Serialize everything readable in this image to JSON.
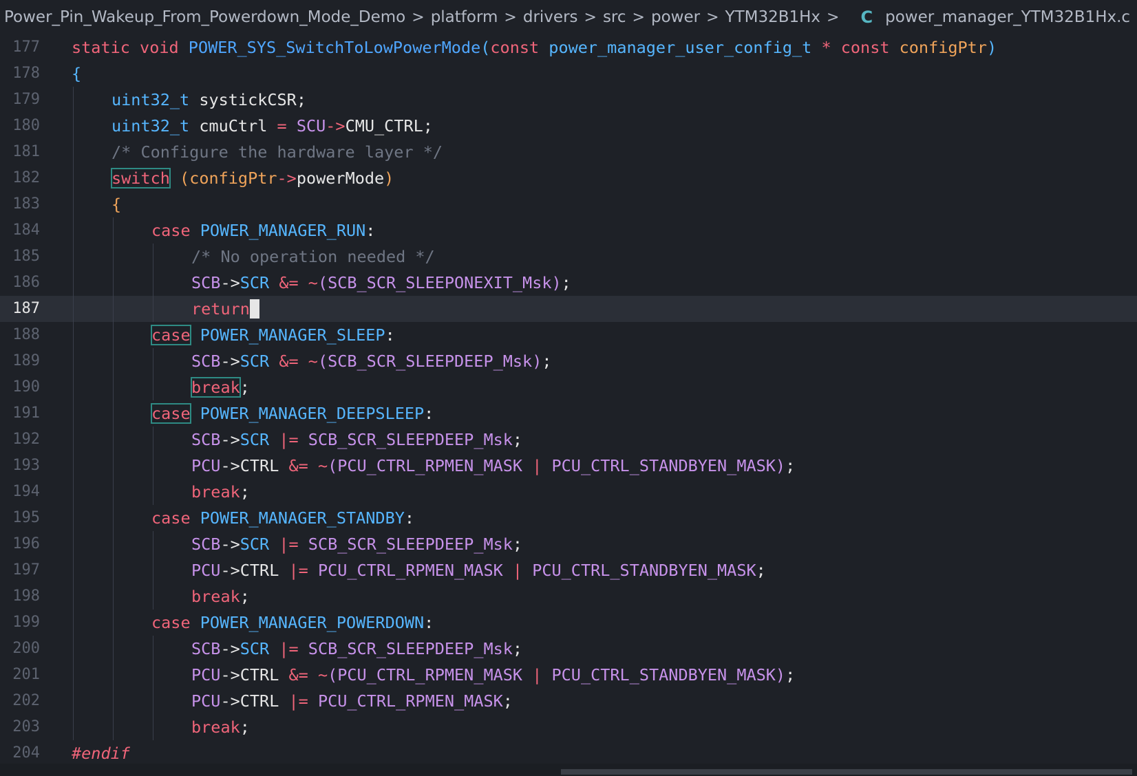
{
  "breadcrumb": {
    "items": [
      "Power_Pin_Wakeup_From_Powerdown_Mode_Demo",
      "platform",
      "drivers",
      "src",
      "power",
      "YTM32B1Hx"
    ],
    "file_icon": "C",
    "file": "power_manager_YTM32B1Hx.c",
    "separator": ">"
  },
  "colors": {
    "keyword": "#f0657a",
    "type": "#56b6ff",
    "function": "#4fa6ff",
    "macro": "#c792ea",
    "param": "#f0a45a",
    "comment": "#6f7684",
    "text": "#e6e6e6",
    "background": "#1e2127"
  },
  "editor": {
    "current_line": 187,
    "lines": [
      {
        "n": "177",
        "indent": 0,
        "tokens": [
          [
            "k",
            "static "
          ],
          [
            "k",
            "void "
          ],
          [
            "f",
            "POWER_SYS_SwitchToLowPowerMode"
          ],
          [
            "p",
            "("
          ],
          [
            "k",
            "const "
          ],
          [
            "t",
            "power_manager_user_config_t "
          ],
          [
            "k",
            "* "
          ],
          [
            "k",
            "const "
          ],
          [
            "a",
            "configPtr"
          ],
          [
            "p",
            ")"
          ]
        ]
      },
      {
        "n": "178",
        "indent": 0,
        "tokens": [
          [
            "p",
            "{"
          ]
        ]
      },
      {
        "n": "179",
        "indent": 1,
        "tokens": [
          [
            "t",
            "uint32_t "
          ],
          [
            "w",
            "systickCSR;"
          ]
        ]
      },
      {
        "n": "180",
        "indent": 1,
        "tokens": [
          [
            "t",
            "uint32_t "
          ],
          [
            "w",
            "cmuCtrl "
          ],
          [
            "k",
            "= "
          ],
          [
            "m",
            "SCU"
          ],
          [
            "k",
            "->"
          ],
          [
            "w",
            "CMU_CTRL;"
          ]
        ]
      },
      {
        "n": "181",
        "indent": 1,
        "tokens": [
          [
            "c",
            "/* Configure the hardware layer */"
          ]
        ]
      },
      {
        "n": "182",
        "indent": 1,
        "tokens": [
          [
            "kb",
            "switch"
          ],
          [
            "w",
            " "
          ],
          [
            "a",
            "(configPtr"
          ],
          [
            "k",
            "->"
          ],
          [
            "w",
            "powerMode"
          ],
          [
            "a",
            ")"
          ]
        ]
      },
      {
        "n": "183",
        "indent": 1,
        "tokens": [
          [
            "a",
            "{"
          ]
        ]
      },
      {
        "n": "184",
        "indent": 2,
        "tokens": [
          [
            "k",
            "case "
          ],
          [
            "t",
            "POWER_MANAGER_RUN"
          ],
          [
            "w",
            ":"
          ]
        ]
      },
      {
        "n": "185",
        "indent": 3,
        "tokens": [
          [
            "c",
            "/* No operation needed */"
          ]
        ]
      },
      {
        "n": "186",
        "indent": 3,
        "tokens": [
          [
            "m",
            "SCB"
          ],
          [
            "w",
            "->"
          ],
          [
            "t",
            "SCR "
          ],
          [
            "k",
            "&= ~"
          ],
          [
            "m",
            "(SCB_SCR_SLEEPONEXIT_Msk"
          ],
          [
            "m",
            ")"
          ],
          [
            "w",
            ";"
          ]
        ]
      },
      {
        "n": "187",
        "indent": 3,
        "tokens": [
          [
            "k",
            "return"
          ],
          [
            "cur",
            ";"
          ]
        ]
      },
      {
        "n": "188",
        "indent": 2,
        "tokens": [
          [
            "kb",
            "case"
          ],
          [
            "w",
            " "
          ],
          [
            "t",
            "POWER_MANAGER_SLEEP"
          ],
          [
            "w",
            ":"
          ]
        ]
      },
      {
        "n": "189",
        "indent": 3,
        "tokens": [
          [
            "m",
            "SCB"
          ],
          [
            "w",
            "->"
          ],
          [
            "t",
            "SCR "
          ],
          [
            "k",
            "&= ~"
          ],
          [
            "m",
            "(SCB_SCR_SLEEPDEEP_Msk)"
          ],
          [
            "w",
            ";"
          ]
        ]
      },
      {
        "n": "190",
        "indent": 3,
        "tokens": [
          [
            "kb",
            "break"
          ],
          [
            "w",
            ";"
          ]
        ]
      },
      {
        "n": "191",
        "indent": 2,
        "tokens": [
          [
            "kb",
            "case"
          ],
          [
            "w",
            " "
          ],
          [
            "t",
            "POWER_MANAGER_DEEPSLEEP"
          ],
          [
            "w",
            ":"
          ]
        ]
      },
      {
        "n": "192",
        "indent": 3,
        "tokens": [
          [
            "m",
            "SCB"
          ],
          [
            "w",
            "->"
          ],
          [
            "t",
            "SCR "
          ],
          [
            "k",
            "|= "
          ],
          [
            "m",
            "SCB_SCR_SLEEPDEEP_Msk"
          ],
          [
            "w",
            ";"
          ]
        ]
      },
      {
        "n": "193",
        "indent": 3,
        "tokens": [
          [
            "m",
            "PCU"
          ],
          [
            "w",
            "->CTRL "
          ],
          [
            "k",
            "&= ~"
          ],
          [
            "m",
            "(PCU_CTRL_RPMEN_MASK "
          ],
          [
            "k",
            "| "
          ],
          [
            "m",
            "PCU_CTRL_STANDBYEN_MASK)"
          ],
          [
            "w",
            ";"
          ]
        ]
      },
      {
        "n": "194",
        "indent": 3,
        "tokens": [
          [
            "k",
            "break"
          ],
          [
            "w",
            ";"
          ]
        ]
      },
      {
        "n": "195",
        "indent": 2,
        "tokens": [
          [
            "k",
            "case "
          ],
          [
            "t",
            "POWER_MANAGER_STANDBY"
          ],
          [
            "w",
            ":"
          ]
        ]
      },
      {
        "n": "196",
        "indent": 3,
        "tokens": [
          [
            "m",
            "SCB"
          ],
          [
            "w",
            "->"
          ],
          [
            "t",
            "SCR "
          ],
          [
            "k",
            "|= "
          ],
          [
            "m",
            "SCB_SCR_SLEEPDEEP_Msk"
          ],
          [
            "w",
            ";"
          ]
        ]
      },
      {
        "n": "197",
        "indent": 3,
        "tokens": [
          [
            "m",
            "PCU"
          ],
          [
            "w",
            "->CTRL "
          ],
          [
            "k",
            "|= "
          ],
          [
            "m",
            "PCU_CTRL_RPMEN_MASK "
          ],
          [
            "k",
            "| "
          ],
          [
            "m",
            "PCU_CTRL_STANDBYEN_MASK"
          ],
          [
            "w",
            ";"
          ]
        ]
      },
      {
        "n": "198",
        "indent": 3,
        "tokens": [
          [
            "k",
            "break"
          ],
          [
            "w",
            ";"
          ]
        ]
      },
      {
        "n": "199",
        "indent": 2,
        "tokens": [
          [
            "k",
            "case "
          ],
          [
            "t",
            "POWER_MANAGER_POWERDOWN"
          ],
          [
            "w",
            ":"
          ]
        ]
      },
      {
        "n": "200",
        "indent": 3,
        "tokens": [
          [
            "m",
            "SCB"
          ],
          [
            "w",
            "->"
          ],
          [
            "t",
            "SCR "
          ],
          [
            "k",
            "|= "
          ],
          [
            "m",
            "SCB_SCR_SLEEPDEEP_Msk"
          ],
          [
            "w",
            ";"
          ]
        ]
      },
      {
        "n": "201",
        "indent": 3,
        "tokens": [
          [
            "m",
            "PCU"
          ],
          [
            "w",
            "->CTRL "
          ],
          [
            "k",
            "&= ~"
          ],
          [
            "m",
            "(PCU_CTRL_RPMEN_MASK "
          ],
          [
            "k",
            "| "
          ],
          [
            "m",
            "PCU_CTRL_STANDBYEN_MASK)"
          ],
          [
            "w",
            ";"
          ]
        ]
      },
      {
        "n": "202",
        "indent": 3,
        "tokens": [
          [
            "m",
            "PCU"
          ],
          [
            "w",
            "->CTRL "
          ],
          [
            "k",
            "|= "
          ],
          [
            "m",
            "PCU_CTRL_RPMEN_MASK"
          ],
          [
            "w",
            ";"
          ]
        ]
      },
      {
        "n": "203",
        "indent": 3,
        "tokens": [
          [
            "k",
            "break"
          ],
          [
            "w",
            ";"
          ]
        ]
      },
      {
        "n": "204",
        "indent": 0,
        "tokens": [
          [
            "ki",
            "#endif"
          ]
        ]
      }
    ]
  }
}
